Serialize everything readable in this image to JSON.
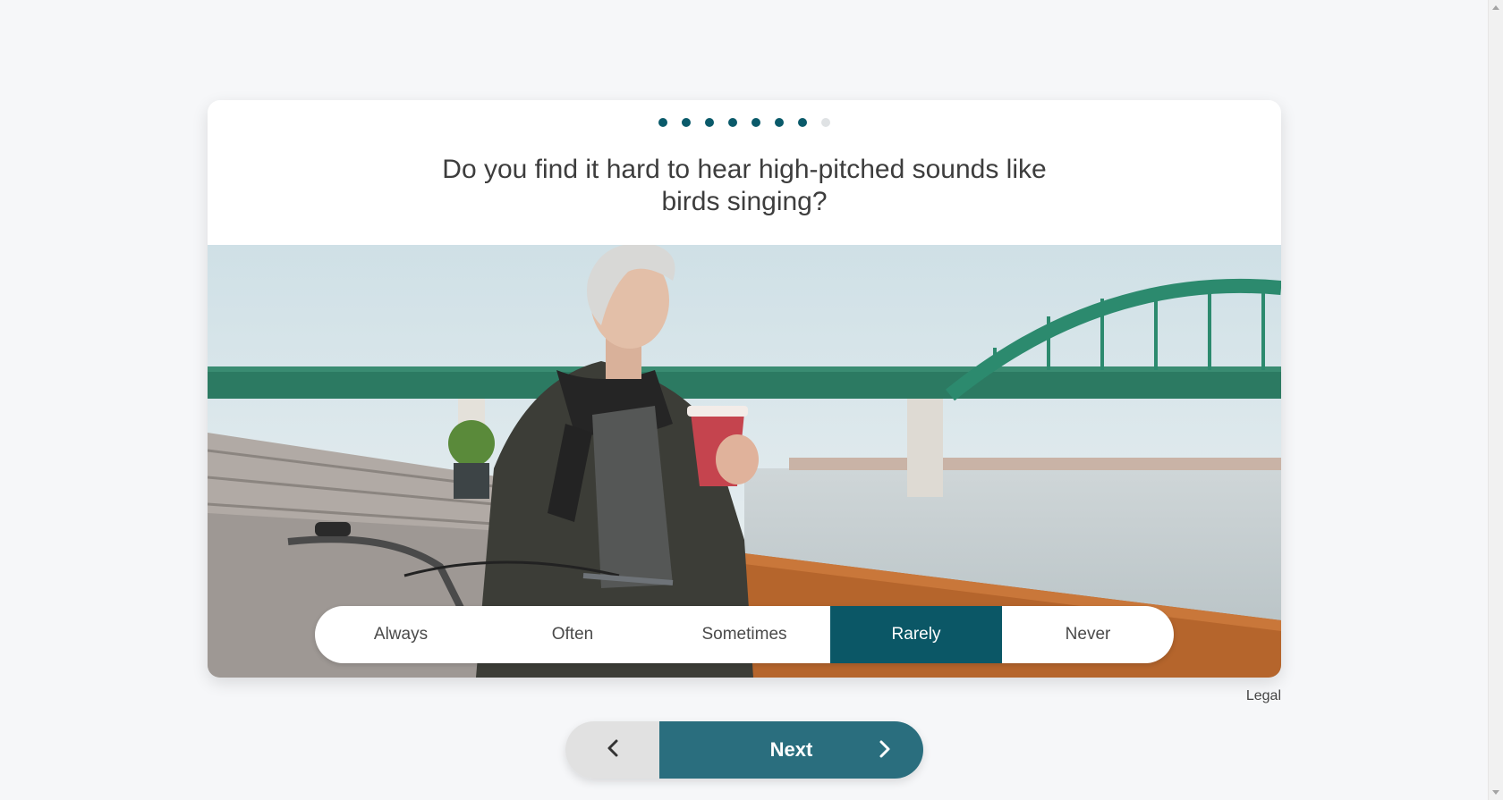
{
  "progress": {
    "total_steps": 8,
    "completed_steps": 7
  },
  "question": {
    "text": "Do you find it hard to hear high-pitched sounds like birds singing?"
  },
  "answers": {
    "options": [
      {
        "label": "Always",
        "selected": false
      },
      {
        "label": "Often",
        "selected": false
      },
      {
        "label": "Sometimes",
        "selected": false
      },
      {
        "label": "Rarely",
        "selected": true
      },
      {
        "label": "Never",
        "selected": false
      }
    ]
  },
  "footer": {
    "legal_label": "Legal"
  },
  "navigation": {
    "back_icon": "chevron-left-icon",
    "next_label": "Next",
    "next_icon": "chevron-right-icon"
  },
  "colors": {
    "primary": "#0b5766",
    "next_button": "#2a6e7e",
    "back_button": "#e1e1e1",
    "page_background": "#f6f7f9"
  }
}
